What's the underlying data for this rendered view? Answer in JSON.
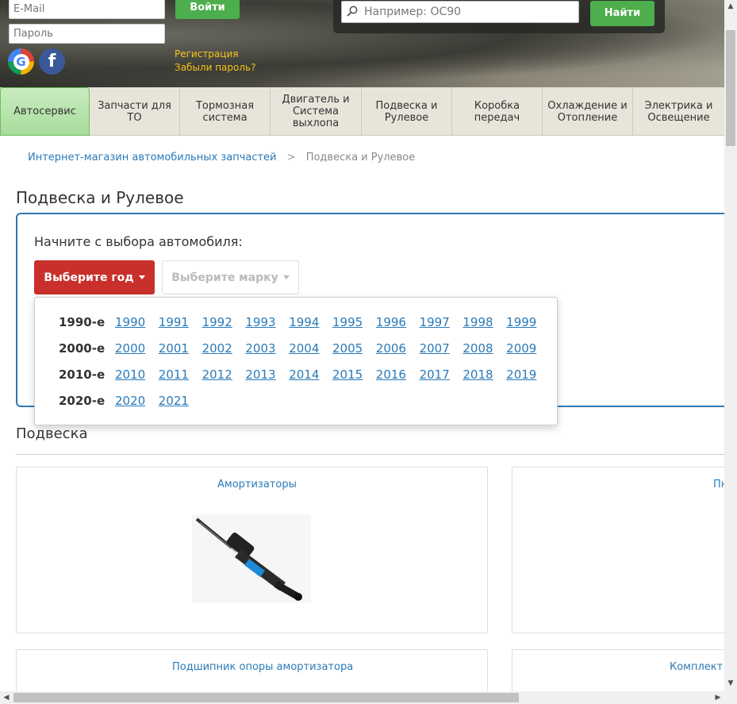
{
  "login": {
    "email_placeholder": "E-Mail",
    "password_placeholder": "Пароль",
    "login_label": "Войти",
    "register_link": "Регистрация",
    "forgot_link": "Забыли пароль?"
  },
  "search": {
    "placeholder": "Например: OC90",
    "button_label": "Найти"
  },
  "nav": [
    {
      "label": "Автосервис",
      "active": true
    },
    {
      "label": "Запчасти для ТО"
    },
    {
      "label": "Тормозная система"
    },
    {
      "label": "Двигатель и Система выхлопа"
    },
    {
      "label": "Подвеска и Рулевое"
    },
    {
      "label": "Коробка передач"
    },
    {
      "label": "Охлаждение и Отопление"
    },
    {
      "label": "Электрика и Освещение"
    }
  ],
  "breadcrumb": {
    "home": "Интернет-магазин автомобильных запчастей",
    "separator": ">",
    "current": "Подвеска и Рулевое"
  },
  "page_title": "Подвеска и Рулевое",
  "selector": {
    "label": "Начните с выбора автомобиля:",
    "year_button": "Выберите год",
    "brand_button": "Выберите марку",
    "decades": [
      {
        "label": "1990-е",
        "years": [
          "1990",
          "1991",
          "1992",
          "1993",
          "1994",
          "1995",
          "1996",
          "1997",
          "1998",
          "1999"
        ]
      },
      {
        "label": "2000-е",
        "years": [
          "2000",
          "2001",
          "2002",
          "2003",
          "2004",
          "2005",
          "2006",
          "2007",
          "2008",
          "2009"
        ]
      },
      {
        "label": "2010-е",
        "years": [
          "2010",
          "2011",
          "2012",
          "2013",
          "2014",
          "2015",
          "2016",
          "2017",
          "2018",
          "2019"
        ]
      },
      {
        "label": "2020-е",
        "years": [
          "2020",
          "2021"
        ]
      }
    ]
  },
  "section": {
    "title": "Подвеска",
    "cards": [
      {
        "title": "Амортизаторы"
      },
      {
        "title": "Пн"
      },
      {
        "title": "Подшипник опоры амортизатора"
      },
      {
        "title": "Комплект п"
      }
    ]
  },
  "colors": {
    "accent_green": "#4cae4c",
    "year_button_red": "#c9302c",
    "link_blue": "#2a7ab8",
    "panel_border": "#2e78b0",
    "auth_link_yellow": "#f5c518"
  }
}
